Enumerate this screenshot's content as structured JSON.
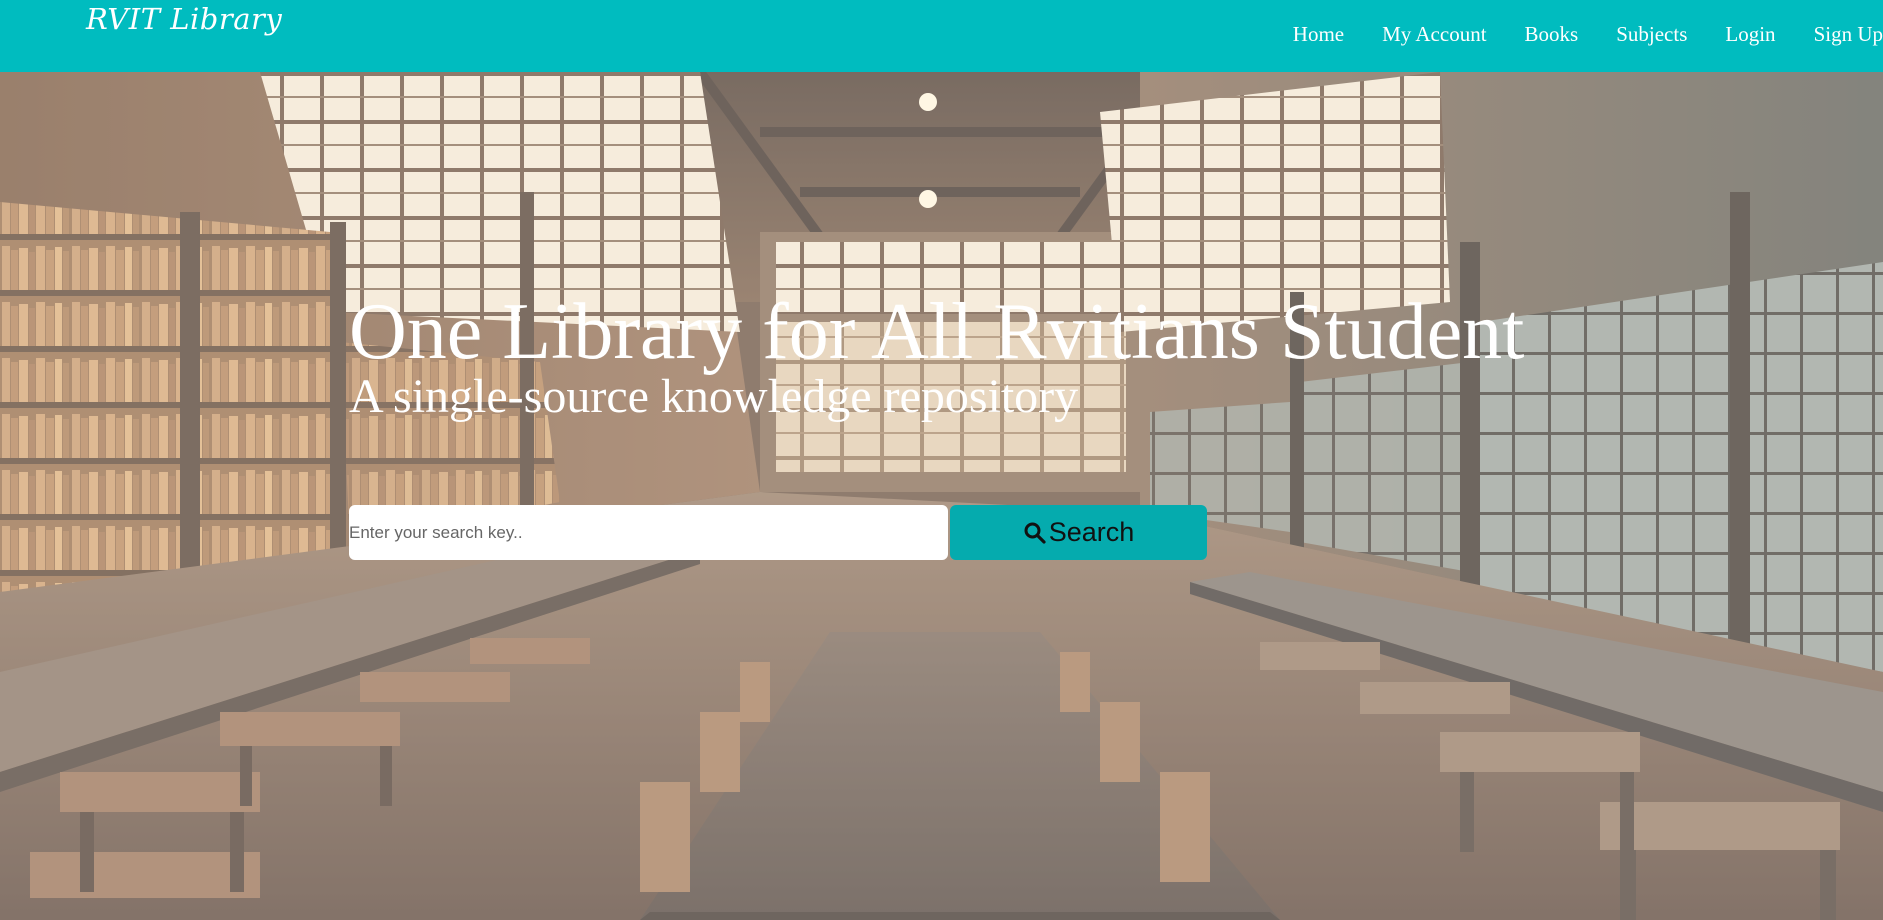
{
  "brand": {
    "name": "RVIT Library"
  },
  "nav": {
    "items": [
      {
        "label": "Home"
      },
      {
        "label": "My Account"
      },
      {
        "label": "Books"
      },
      {
        "label": "Subjects"
      },
      {
        "label": "Login"
      },
      {
        "label": "Sign Up"
      }
    ]
  },
  "hero": {
    "title": "One Library for All Rvitians Student",
    "subtitle": "A single-source knowledge repository",
    "background_icon": "library-interior-photo"
  },
  "search": {
    "placeholder": "Enter your search key..",
    "value": "",
    "button_label": "Search",
    "button_icon": "search-icon"
  },
  "colors": {
    "navbar": "#00BCBF",
    "search_button": "#05ABAE",
    "text": "#FFFFFF"
  }
}
